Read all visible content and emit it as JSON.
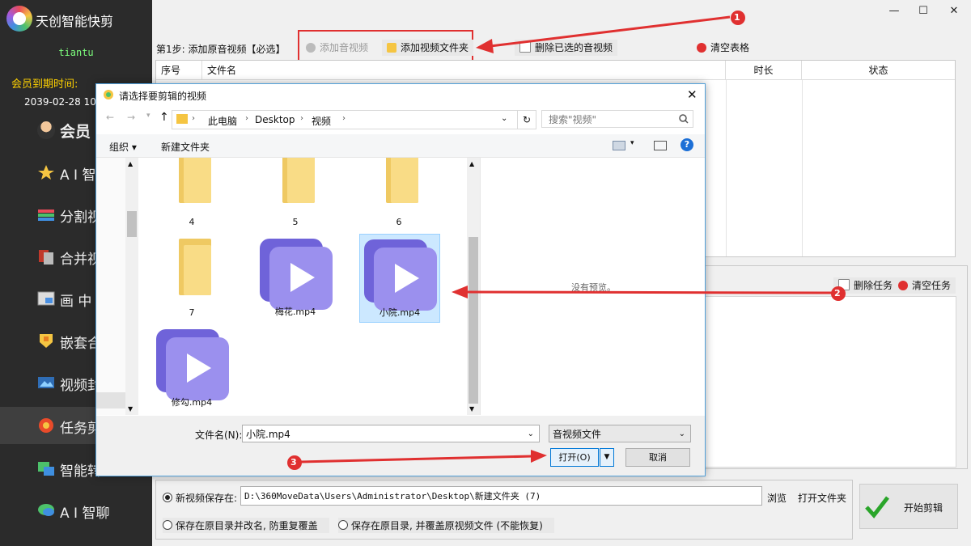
{
  "app": {
    "name": "天创智能快剪",
    "user": "tiantu",
    "member_label": "会员到期时间:",
    "member_date": "2039-02-28 10"
  },
  "nav": [
    {
      "label": "会员"
    },
    {
      "label": "A I 智"
    },
    {
      "label": "分割视"
    },
    {
      "label": "合并视"
    },
    {
      "label": "画 中 画"
    },
    {
      "label": "嵌套合"
    },
    {
      "label": "视频封"
    },
    {
      "label": "任务剪"
    },
    {
      "label": "智能转"
    },
    {
      "label": "A I 智聊"
    }
  ],
  "window": {
    "minimize": "—",
    "maximize": "☐",
    "close": "✕"
  },
  "toolbar": {
    "step": "第1步: 添加原音视频【必选】",
    "add_audio": "添加音视频",
    "add_folder": "添加视频文件夹",
    "delete_selected": "删除已选的音视频",
    "clear_table": "清空表格"
  },
  "table": {
    "headers": [
      "序号",
      "文件名",
      "时长",
      "状态"
    ]
  },
  "task": {
    "delete": "删除任务",
    "clear": "清空任务"
  },
  "save": {
    "option1": "新视频保存在:",
    "path": "D:\\360MoveData\\Users\\Administrator\\Desktop\\新建文件夹 (7)",
    "browse": "浏览",
    "open_folder": "打开文件夹",
    "option2": "保存在原目录并改名, 防重复覆盖",
    "option3": "保存在原目录, 并覆盖原视频文件 (不能恢复)",
    "start": "开始剪辑"
  },
  "dialog": {
    "title": "请选择要剪辑的视频",
    "breadcrumb": [
      "此电脑",
      "Desktop",
      "视频"
    ],
    "search_placeholder": "搜索\"视频\"",
    "organize": "组织",
    "new_folder": "新建文件夹",
    "help": "?",
    "files": [
      {
        "name": "4",
        "type": "folder"
      },
      {
        "name": "5",
        "type": "folder"
      },
      {
        "name": "6",
        "type": "folder"
      },
      {
        "name": "7",
        "type": "folder"
      },
      {
        "name": "梅花.mp4",
        "type": "video"
      },
      {
        "name": "小院.mp4",
        "type": "video",
        "selected": true
      },
      {
        "name": "修勾.mp4",
        "type": "video"
      }
    ],
    "preview": "没有预览。",
    "filename_label": "文件名(N):",
    "filename_value": "小院.mp4",
    "filetype": "音视频文件",
    "open": "打开(O)",
    "cancel": "取消"
  },
  "annotations": [
    "1",
    "2",
    "3"
  ],
  "colors": {
    "sidebar": "#2b2b2b",
    "accent_red": "#e03030",
    "video_icon": "#9b90ee",
    "folder": "#f9dc86"
  }
}
